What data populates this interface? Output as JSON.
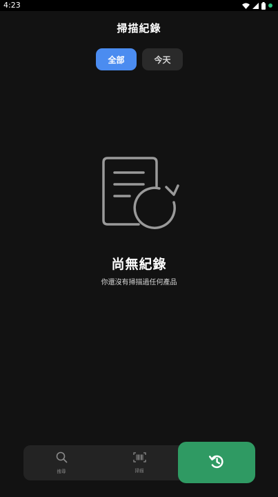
{
  "status_bar": {
    "time": "4:23",
    "icons": [
      "wifi-icon",
      "cellular-signal-icon",
      "battery-icon",
      "notification-dot-icon"
    ]
  },
  "header": {
    "title": "掃描紀錄"
  },
  "filter_tabs": [
    {
      "label": "全部",
      "selected": true
    },
    {
      "label": "今天",
      "selected": false
    }
  ],
  "empty_state": {
    "icon": "document-history-icon",
    "title": "尚無紀錄",
    "subtitle": "你還沒有掃描過任何產品"
  },
  "bottom_nav": {
    "items": [
      {
        "label": "搜尋",
        "icon": "search-icon"
      },
      {
        "label": "掃描",
        "icon": "barcode-scan-icon"
      }
    ],
    "active_item": {
      "icon": "history-icon"
    }
  },
  "colors": {
    "background": "#121212",
    "accent_blue": "#4b8cf0",
    "active_green": "#2f9a63"
  }
}
